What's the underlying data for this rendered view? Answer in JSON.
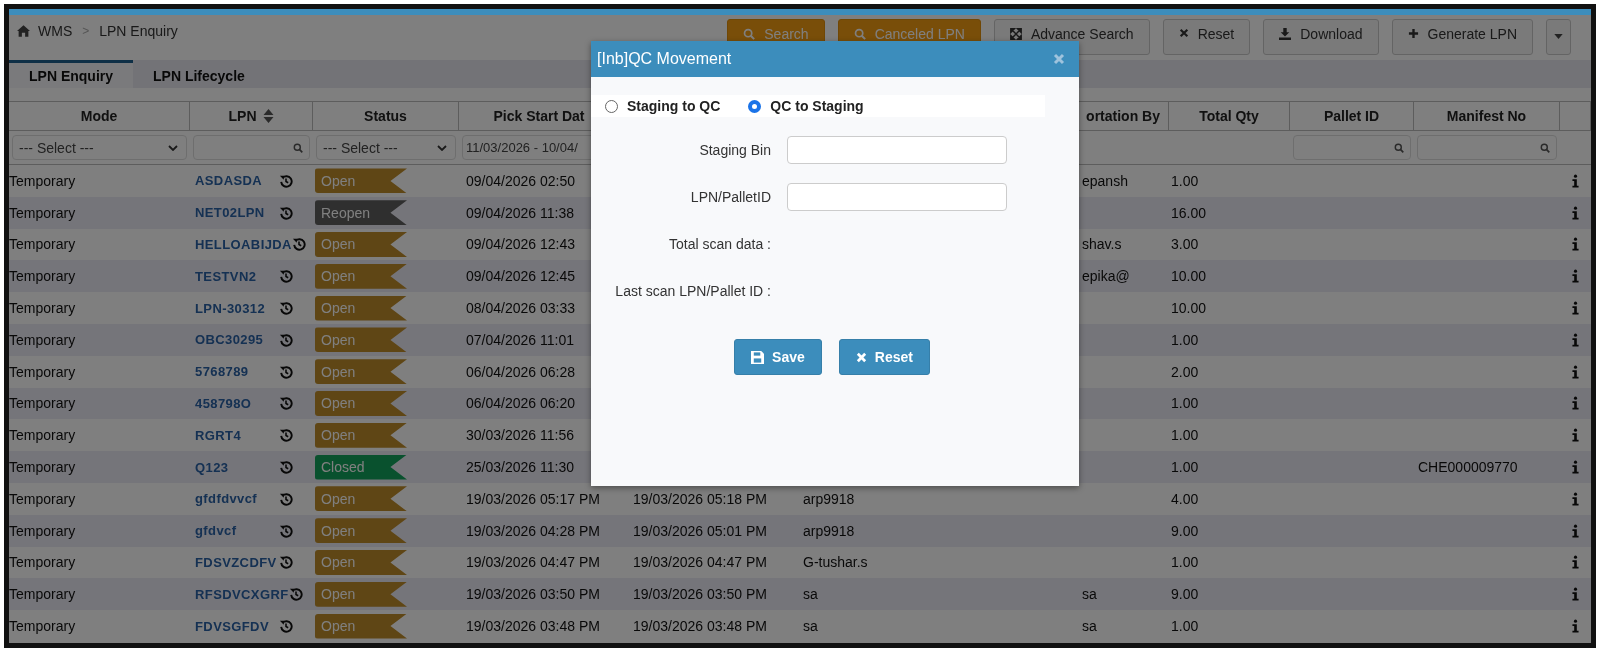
{
  "breadcrumb": {
    "root": "WMS",
    "separator": ">",
    "current": "LPN Enquiry"
  },
  "toolbar": [
    {
      "label": "Search",
      "kind": "primary"
    },
    {
      "label": "Canceled LPN",
      "kind": "primary"
    },
    {
      "label": "Advance Search",
      "kind": "default"
    },
    {
      "label": "Reset",
      "kind": "default"
    },
    {
      "label": "Download",
      "kind": "default"
    },
    {
      "label": "Generate LPN",
      "kind": "default"
    }
  ],
  "tabs": [
    {
      "label": "LPN Enquiry",
      "selected": true
    },
    {
      "label": "LPN Lifecycle",
      "selected": false
    }
  ],
  "table": {
    "columns": [
      {
        "label": "Mode"
      },
      {
        "label": "LPN",
        "sortable": true
      },
      {
        "label": "Status"
      },
      {
        "label": "Pick Start Dat"
      },
      {},
      {},
      {
        "label": "ortation By"
      },
      {
        "label": "Total Qty"
      },
      {
        "label": "Pallet ID"
      },
      {
        "label": "Manifest No"
      }
    ],
    "filters": [
      {
        "kind": "select",
        "value": "--- Select ---"
      },
      {
        "kind": "search"
      },
      {
        "kind": "select",
        "value": "--- Select ---"
      },
      {
        "kind": "date",
        "value": "11/03/2026 - 10/04/"
      },
      {
        "kind": "none"
      },
      {
        "kind": "none"
      },
      {
        "kind": "none"
      },
      {
        "kind": "none"
      },
      {
        "kind": "search"
      },
      {
        "kind": "search"
      }
    ],
    "rows": [
      {
        "mode": "Temporary",
        "lpn": "ASDASDA",
        "status": {
          "label": "Open",
          "kind": "open"
        },
        "pick_start_date": "09/04/2026 02:50",
        "transportation_by": "epansh",
        "total_qty": "1.00"
      },
      {
        "mode": "Temporary",
        "lpn": "NET02LPN",
        "status": {
          "label": "Reopen",
          "kind": "reopen"
        },
        "pick_start_date": "09/04/2026 11:38",
        "total_qty": "16.00"
      },
      {
        "mode": "Temporary",
        "lpn": "HELLOABIJDA",
        "status": {
          "label": "Open",
          "kind": "open"
        },
        "pick_start_date": "09/04/2026 12:43",
        "transportation_by": "shav.s",
        "total_qty": "3.00"
      },
      {
        "mode": "Temporary",
        "lpn": "TESTVN2",
        "status": {
          "label": "Open",
          "kind": "open"
        },
        "pick_start_date": "09/04/2026 12:45",
        "transportation_by": "epika@",
        "total_qty": "10.00"
      },
      {
        "mode": "Temporary",
        "lpn": "LPN-30312",
        "status": {
          "label": "Open",
          "kind": "open"
        },
        "pick_start_date": "08/04/2026 03:33",
        "total_qty": "10.00"
      },
      {
        "mode": "Temporary",
        "lpn": "OBC30295",
        "status": {
          "label": "Open",
          "kind": "open"
        },
        "pick_start_date": "07/04/2026 11:01",
        "total_qty": "1.00"
      },
      {
        "mode": "Temporary",
        "lpn": "5768789",
        "status": {
          "label": "Open",
          "kind": "open"
        },
        "pick_start_date": "06/04/2026 06:28",
        "total_qty": "2.00"
      },
      {
        "mode": "Temporary",
        "lpn": "458798O",
        "status": {
          "label": "Open",
          "kind": "open"
        },
        "pick_start_date": "06/04/2026 06:20",
        "total_qty": "1.00"
      },
      {
        "mode": "Temporary",
        "lpn": "RGRT4",
        "status": {
          "label": "Open",
          "kind": "open"
        },
        "pick_start_date": "30/03/2026 11:56",
        "total_qty": "1.00"
      },
      {
        "mode": "Temporary",
        "lpn": "Q123",
        "status": {
          "label": "Closed",
          "kind": "closed"
        },
        "pick_start_date": "25/03/2026 11:30",
        "total_qty": "1.00",
        "manifest_no": "CHE000009770"
      },
      {
        "mode": "Temporary",
        "lpn": "gfdfdvvcf",
        "status": {
          "label": "Open",
          "kind": "open"
        },
        "pick_start_date": "19/03/2026 05:17 PM",
        "column_5": "19/03/2026 05:18 PM",
        "column_6": "arp9918",
        "total_qty": "4.00"
      },
      {
        "mode": "Temporary",
        "lpn": "gfdvcf",
        "status": {
          "label": "Open",
          "kind": "open"
        },
        "pick_start_date": "19/03/2026 04:28 PM",
        "column_5": "19/03/2026 05:01 PM",
        "column_6": "arp9918",
        "total_qty": "9.00"
      },
      {
        "mode": "Temporary",
        "lpn": "FDSVZCDFV",
        "status": {
          "label": "Open",
          "kind": "open"
        },
        "pick_start_date": "19/03/2026 04:47 PM",
        "column_5": "19/03/2026 04:47 PM",
        "column_6": "G-tushar.s",
        "total_qty": "1.00"
      },
      {
        "mode": "Temporary",
        "lpn": "RFSDVCXGRF",
        "status": {
          "label": "Open",
          "kind": "open"
        },
        "pick_start_date": "19/03/2026 03:50 PM",
        "column_5": "19/03/2026 03:50 PM",
        "column_6": "sa",
        "transportation_by": "sa",
        "total_qty": "9.00"
      },
      {
        "mode": "Temporary",
        "lpn": "FDVSGFDV",
        "status": {
          "label": "Open",
          "kind": "open"
        },
        "pick_start_date": "19/03/2026 03:48 PM",
        "column_5": "19/03/2026 03:48 PM",
        "column_6": "sa",
        "transportation_by": "sa",
        "total_qty": "1.00"
      }
    ]
  },
  "dialog": {
    "title": "[Inb]QC Movement",
    "options": [
      {
        "label": "Staging to QC",
        "selected": false
      },
      {
        "label": "QC to Staging",
        "selected": true
      }
    ],
    "fields": [
      {
        "label": "Staging Bin",
        "kind": "input"
      },
      {
        "label": "LPN/PalletID",
        "kind": "input"
      },
      {
        "label": "Total scan data :",
        "kind": "readout"
      },
      {
        "label": "Last scan LPN/Pallet ID :",
        "kind": "readout"
      }
    ],
    "buttons": [
      {
        "label": "Save",
        "kind": "save"
      },
      {
        "label": "Reset",
        "kind": "reset"
      }
    ]
  }
}
